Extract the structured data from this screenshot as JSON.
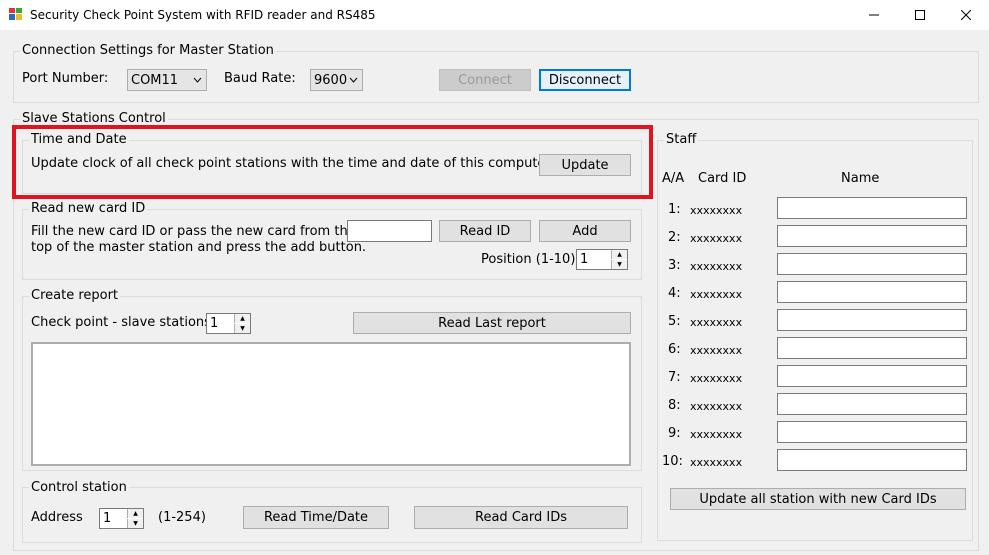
{
  "window": {
    "title": "Security Check Point System with RFID reader and RS485"
  },
  "connection": {
    "group_label": "Connection Settings for Master Station",
    "port_label": "Port Number:",
    "port_value": "COM11",
    "baud_label": "Baud Rate:",
    "baud_value": "9600",
    "connect_label": "Connect",
    "disconnect_label": "Disconnect"
  },
  "slave": {
    "group_label": "Slave Stations Control"
  },
  "time_date": {
    "group_label": "Time and Date",
    "description": "Update clock of all check point stations with the time and date of this computer.",
    "update_label": "Update"
  },
  "read_card": {
    "group_label": "Read new card ID",
    "desc_line1": "Fill the new card ID or pass the new card from the",
    "desc_line2": "top of the master station and press the add button.",
    "input_value": "",
    "read_id_label": "Read ID",
    "add_label": "Add",
    "position_label": "Position (1-10)",
    "position_value": "1"
  },
  "report": {
    "group_label": "Create report",
    "checkpoint_label": "Check point - slave stations:",
    "checkpoint_value": "1",
    "read_last_label": "Read Last report",
    "report_text": ""
  },
  "control": {
    "group_label": "Control station",
    "address_label": "Address",
    "address_value": "1",
    "range_label": "(1-254)",
    "read_time_label": "Read Time/Date",
    "read_cards_label": "Read Card IDs"
  },
  "staff": {
    "group_label": "Staff",
    "col_aa": "A/A",
    "col_card": "Card ID",
    "col_name": "Name",
    "rows": [
      {
        "num": "1:",
        "card": "xxxxxxxx",
        "name": ""
      },
      {
        "num": "2:",
        "card": "xxxxxxxx",
        "name": ""
      },
      {
        "num": "3:",
        "card": "xxxxxxxx",
        "name": ""
      },
      {
        "num": "4:",
        "card": "xxxxxxxx",
        "name": ""
      },
      {
        "num": "5:",
        "card": "xxxxxxxx",
        "name": ""
      },
      {
        "num": "6:",
        "card": "xxxxxxxx",
        "name": ""
      },
      {
        "num": "7:",
        "card": "xxxxxxxx",
        "name": ""
      },
      {
        "num": "8:",
        "card": "xxxxxxxx",
        "name": ""
      },
      {
        "num": "9:",
        "card": "xxxxxxxx",
        "name": ""
      },
      {
        "num": "10:",
        "card": "xxxxxxxx",
        "name": ""
      }
    ],
    "update_all_label": "Update all station with new Card IDs"
  },
  "colors": {
    "highlight": "#e0141e",
    "focus_border": "#0078d7"
  }
}
